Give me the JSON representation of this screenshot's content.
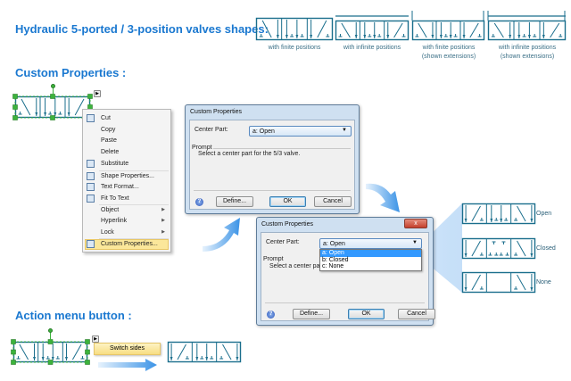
{
  "headings": {
    "shapes": "Hydraulic 5-ported / 3-position valves shapes:",
    "custom": "Custom Properties :",
    "action": "Action menu button :"
  },
  "shape_captions": [
    {
      "line1": "with finite positions",
      "line2": ""
    },
    {
      "line1": "with infinite positions",
      "line2": ""
    },
    {
      "line1": "with finite positions",
      "line2": "(shown extensions)"
    },
    {
      "line1": "with infinite positions",
      "line2": "(shown extensions)"
    }
  ],
  "context_menu": {
    "items": [
      {
        "label": "Cut",
        "icon": "scissors-icon"
      },
      {
        "label": "Copy",
        "icon": ""
      },
      {
        "label": "Paste",
        "icon": ""
      },
      {
        "label": "Delete",
        "icon": ""
      },
      {
        "label": "Substitute",
        "icon": "substitute-icon"
      },
      {
        "label": "Shape Properties...",
        "icon": "shape-properties-icon"
      },
      {
        "label": "Text Format...",
        "icon": "text-format-icon"
      },
      {
        "label": "Fit To Text",
        "icon": "fit-to-text-icon"
      },
      {
        "label": "Object",
        "icon": "",
        "submenu": true
      },
      {
        "label": "Hyperlink",
        "icon": "",
        "submenu": true
      },
      {
        "label": "Lock",
        "icon": "",
        "submenu": true
      },
      {
        "label": "Custom Properties...",
        "icon": "custom-properties-icon",
        "highlighted": true
      }
    ]
  },
  "dialog": {
    "title": "Custom Properties",
    "close": "x",
    "center_part_label": "Center Part:",
    "center_part_value": "a:  Open",
    "prompt_label": "Prompt",
    "prompt_text": "Select a center part for the 5/3 valve.",
    "define": "Define...",
    "ok": "OK",
    "cancel": "Cancel",
    "help": "?"
  },
  "dialog2": {
    "prompt_text": "Select a center part f",
    "options": [
      "a:  Open",
      "b:  Closed",
      "c:  None"
    ]
  },
  "variants": [
    "Open",
    "Closed",
    "None"
  ],
  "action_menu": {
    "item": "Switch sides"
  },
  "colors": {
    "heading": "#1a78d0",
    "valve": "#1a6e8c",
    "highlight": "#fbe79a"
  }
}
